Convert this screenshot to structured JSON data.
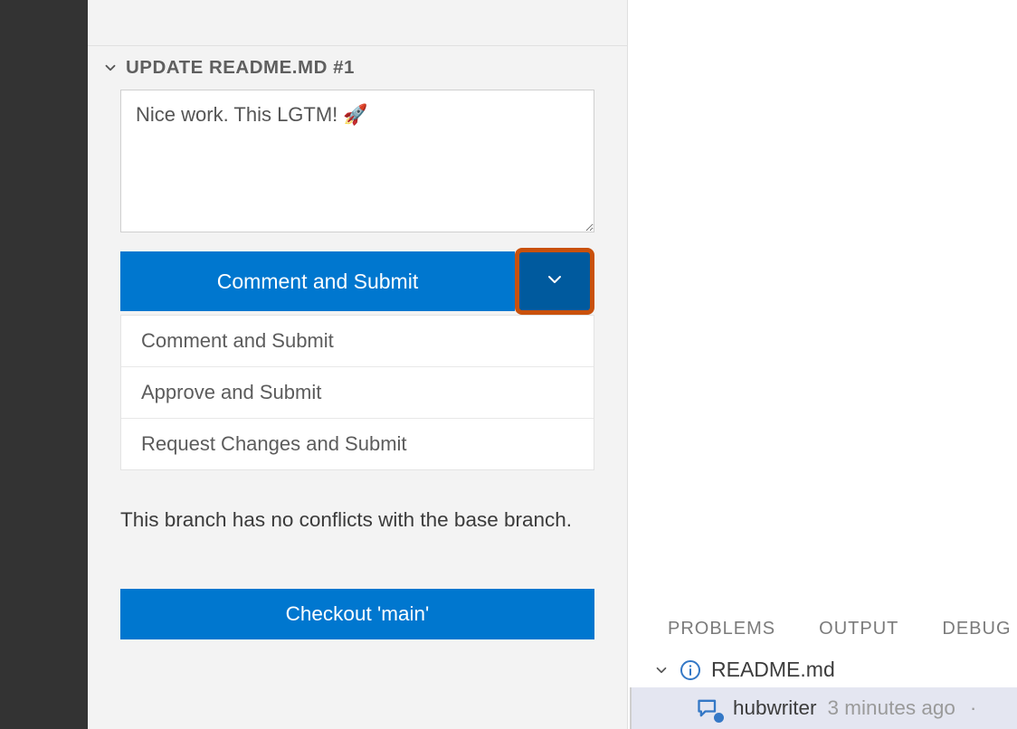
{
  "header": {
    "title": "UPDATE README.MD #1"
  },
  "comment": {
    "value": "Nice work. This LGTM! 🚀"
  },
  "primary_button": {
    "label": "Comment and Submit"
  },
  "dropdown_options": {
    "0": "Comment and Submit",
    "1": "Approve and Submit",
    "2": "Request Changes and Submit"
  },
  "status": {
    "text": "This branch has no conflicts with the base branch."
  },
  "checkout": {
    "label": "Checkout 'main'"
  },
  "bottom_tabs": {
    "problems": "PROBLEMS",
    "output": "OUTPUT",
    "debug": "DEBUG"
  },
  "problems": {
    "file": "README.md",
    "entry": {
      "author": "hubwriter",
      "time": "3 minutes ago"
    }
  },
  "colors": {
    "accent": "#0077cf",
    "accent_dark": "#005a9e",
    "highlight_border": "#c9510c",
    "activity_bar": "#333333",
    "sidebar_bg": "#f3f3f3"
  },
  "icons": {
    "chevron_down": "chevron-down-icon",
    "info": "info-icon",
    "comment_discussion": "comment-discussion-icon"
  }
}
